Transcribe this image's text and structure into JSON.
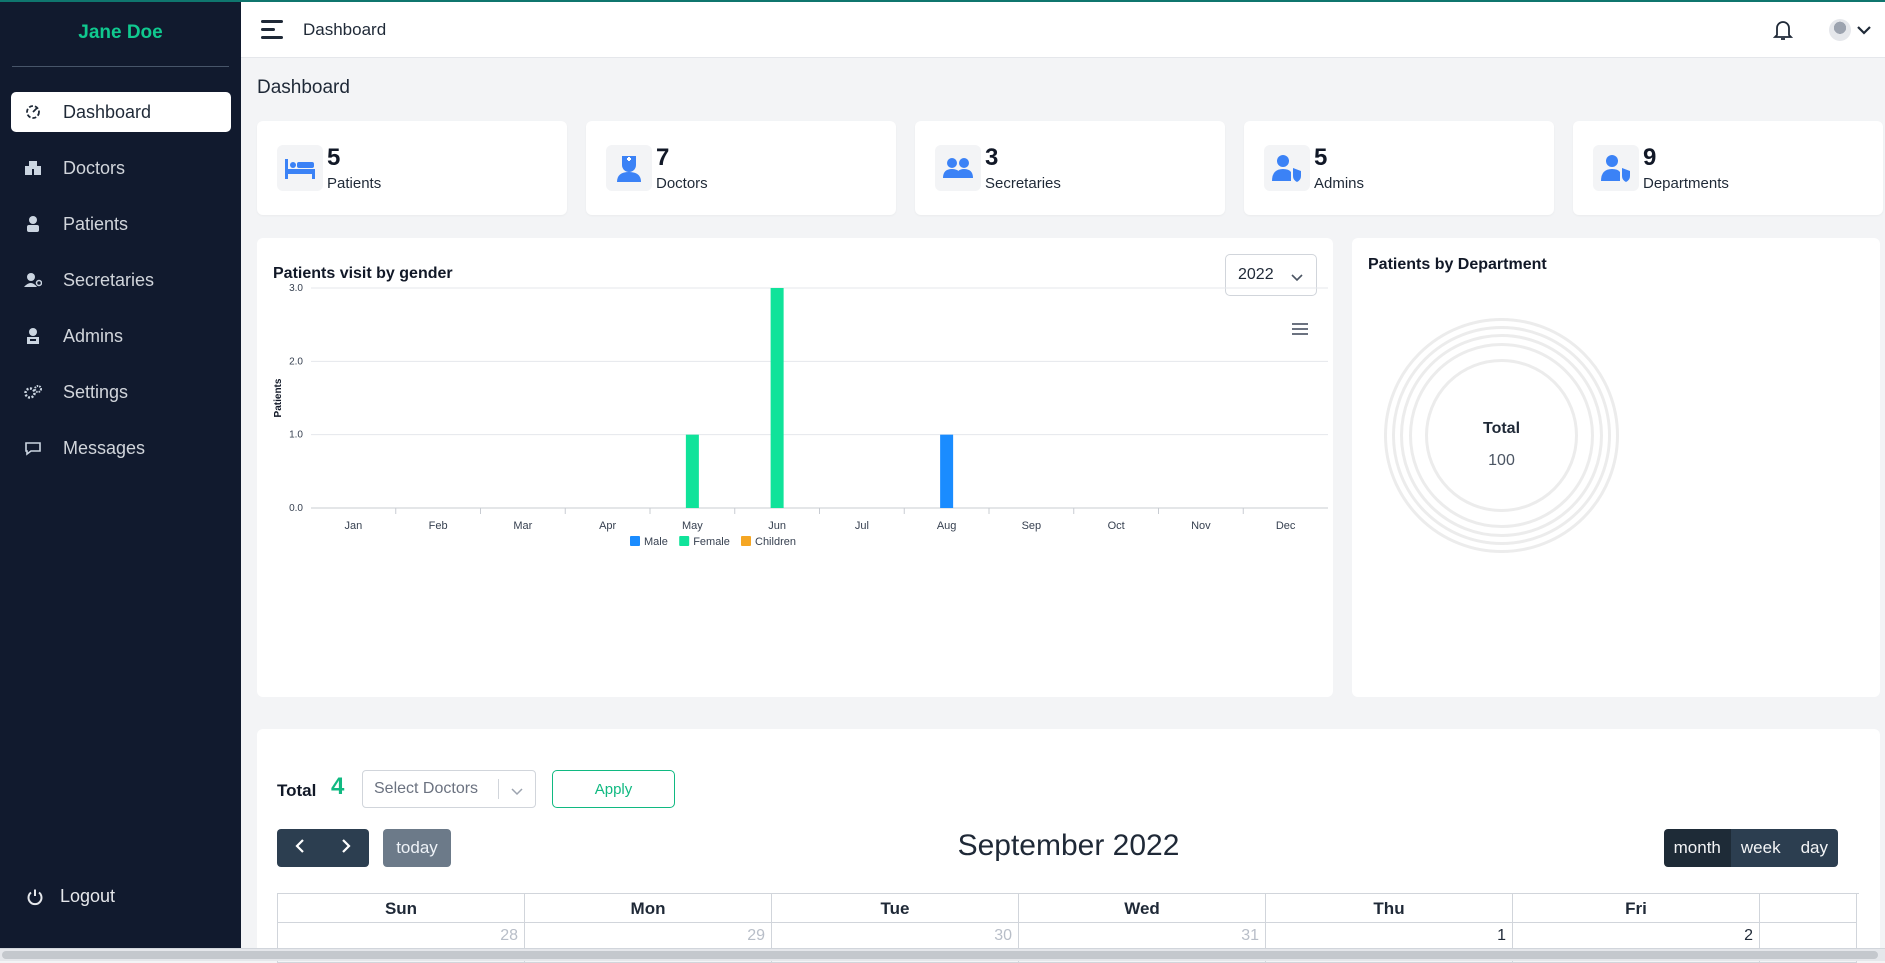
{
  "sidebar": {
    "user_name": "Jane Doe",
    "items": [
      {
        "label": "Dashboard",
        "icon": "dashboard-icon",
        "active": true
      },
      {
        "label": "Doctors",
        "icon": "doctors-icon"
      },
      {
        "label": "Patients",
        "icon": "patients-icon"
      },
      {
        "label": "Secretaries",
        "icon": "secretaries-icon"
      },
      {
        "label": "Admins",
        "icon": "admins-icon"
      },
      {
        "label": "Settings",
        "icon": "settings-icon"
      },
      {
        "label": "Messages",
        "icon": "messages-icon"
      }
    ],
    "logout_label": "Logout"
  },
  "topbar": {
    "title": "Dashboard",
    "icons": [
      "hamburger-icon",
      "bell-icon",
      "avatar",
      "chevron-down-icon"
    ]
  },
  "page_title": "Dashboard",
  "stats": [
    {
      "value": "5",
      "label": "Patients",
      "icon": "bed-icon"
    },
    {
      "value": "7",
      "label": "Doctors",
      "icon": "doctor-icon"
    },
    {
      "value": "3",
      "label": "Secretaries",
      "icon": "users-icon"
    },
    {
      "value": "5",
      "label": "Admins",
      "icon": "admin-shield-icon"
    },
    {
      "value": "9",
      "label": "Departments",
      "icon": "department-shield-icon"
    }
  ],
  "gender_chart": {
    "title": "Patients visit by gender",
    "year": "2022"
  },
  "chart_data": {
    "type": "bar",
    "title": "Patients visit by gender",
    "xlabel": "",
    "ylabel": "Patients",
    "categories": [
      "Jan",
      "Feb",
      "Mar",
      "Apr",
      "May",
      "Jun",
      "Jul",
      "Aug",
      "Sep",
      "Oct",
      "Nov",
      "Dec"
    ],
    "series": [
      {
        "name": "Male",
        "color": "#1a8cff",
        "values": [
          0,
          0,
          0,
          0,
          0,
          0,
          0,
          1,
          0,
          0,
          0,
          0
        ]
      },
      {
        "name": "Female",
        "color": "#10e39a",
        "values": [
          0,
          0,
          0,
          0,
          1,
          3,
          0,
          0,
          0,
          0,
          0,
          0
        ]
      },
      {
        "name": "Children",
        "color": "#f5a623",
        "values": [
          0,
          0,
          0,
          0,
          0,
          0,
          0,
          0,
          0,
          0,
          0,
          0
        ]
      }
    ],
    "yticks": [
      "0.0",
      "1.0",
      "2.0",
      "3.0"
    ],
    "ylim": [
      0,
      3
    ],
    "grid": true,
    "legend": "bottom"
  },
  "dept_chart": {
    "title": "Patients by Department",
    "total_label": "Total",
    "total_value": "100"
  },
  "calendar": {
    "total_label": "Total",
    "total_value": "4",
    "doctor_select_placeholder": "Select Doctors",
    "apply_label": "Apply",
    "today_label": "today",
    "title": "September 2022",
    "views": [
      "month",
      "week",
      "day"
    ],
    "active_view": "month",
    "weekdays": [
      "Sun",
      "Mon",
      "Tue",
      "Wed",
      "Thu",
      "Fri",
      ""
    ],
    "first_row": [
      {
        "day": "28",
        "other": true
      },
      {
        "day": "29",
        "other": true
      },
      {
        "day": "30",
        "other": true
      },
      {
        "day": "31",
        "other": true
      },
      {
        "day": "1",
        "other": false
      },
      {
        "day": "2",
        "other": false
      },
      {
        "day": "",
        "other": false
      }
    ]
  }
}
